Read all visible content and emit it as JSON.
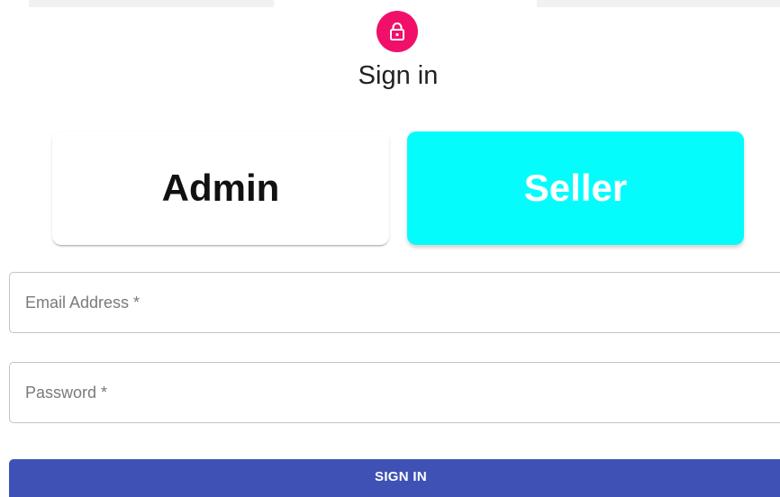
{
  "header": {
    "avatar_icon": "lock-icon",
    "avatar_color": "#f0106a",
    "title": "Sign in"
  },
  "roles": {
    "admin_label": "Admin",
    "seller_label": "Seller",
    "selected": "Seller",
    "seller_color": "#05fcfc"
  },
  "form": {
    "email_placeholder": "Email Address *",
    "email_value": "",
    "password_placeholder": "Password *",
    "password_value": "",
    "submit_label": "SIGN IN",
    "submit_color": "#3f51b5"
  }
}
